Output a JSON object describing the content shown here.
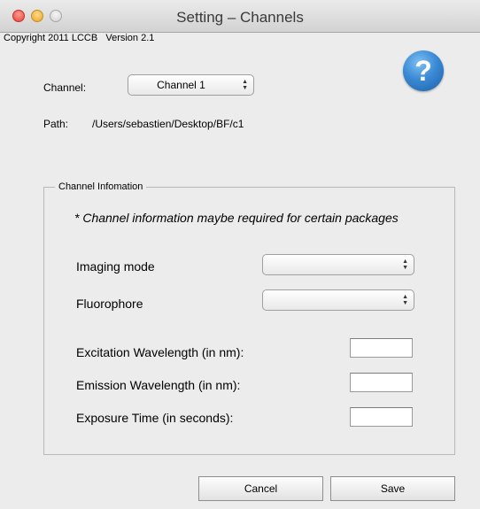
{
  "window": {
    "title": "Setting – Channels"
  },
  "copyright": "Copyright 2011 LCCB   Version 2.1",
  "help_icon": "?",
  "channel": {
    "label": "Channel:",
    "selected": "Channel 1"
  },
  "path": {
    "label": "Path:",
    "value": "/Users/sebastien/Desktop/BF/c1"
  },
  "info_group": {
    "title": "Channel Infomation",
    "note": "* Channel information maybe required for certain packages",
    "imaging_mode_label": "Imaging mode",
    "imaging_mode_value": "",
    "fluorophore_label": "Fluorophore",
    "fluorophore_value": "",
    "excitation_label": "Excitation Wavelength (in nm):",
    "excitation_value": "",
    "emission_label": "Emission Wavelength (in nm):",
    "emission_value": "",
    "exposure_label": "Exposure Time (in seconds):",
    "exposure_value": ""
  },
  "buttons": {
    "cancel": "Cancel",
    "save": "Save"
  },
  "icons": [
    "close-icon",
    "minimize-icon",
    "zoom-icon",
    "help-icon",
    "updown-chevron-icon"
  ],
  "colors": {
    "window_bg": "#ececec",
    "help_blue": "#3a8ad6"
  }
}
